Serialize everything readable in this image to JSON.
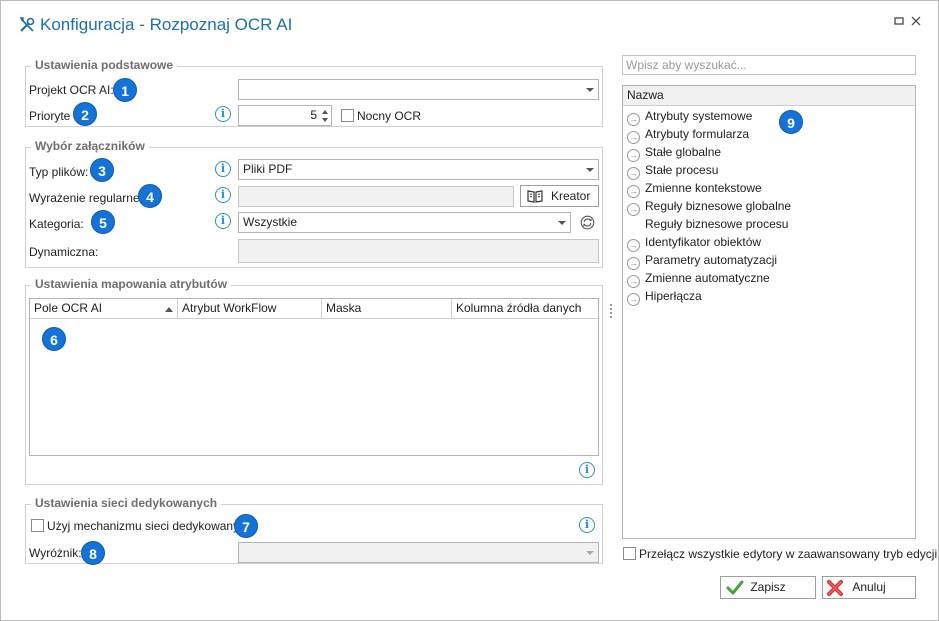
{
  "window": {
    "title": "Konfiguracja - Rozpoznaj OCR AI"
  },
  "basic": {
    "legend": "Ustawienia podstawowe",
    "project_label": "Projekt OCR AI:",
    "project_value": "",
    "priority_label": "Prioryte",
    "priority_value": "5",
    "night_ocr_label": "Nocny OCR",
    "night_ocr_checked": false
  },
  "attachments": {
    "legend": "Wybór załączników",
    "file_type_label": "Typ plików:",
    "file_type_value": "Pliki PDF",
    "regex_label": "Wyrażenie regularne:",
    "regex_value": "",
    "wizard_label": "Kreator",
    "category_label": "Kategoria:",
    "category_value": "Wszystkie",
    "dynamic_label": "Dynamiczna:",
    "dynamic_value": ""
  },
  "mapping": {
    "legend": "Ustawienia mapowania atrybutów",
    "columns": [
      "Pole OCR AI",
      "Atrybut WorkFlow",
      "Maska",
      "Kolumna źródła danych"
    ],
    "rows": []
  },
  "network": {
    "legend": "Ustawienia sieci dedykowanych",
    "use_label": "Użyj mechanizmu sieci dedykowanych",
    "use_checked": false,
    "marker_label": "Wyróżnik:",
    "marker_value": ""
  },
  "badges": [
    "1",
    "2",
    "3",
    "4",
    "5",
    "6",
    "7",
    "8",
    "9"
  ],
  "right": {
    "search_placeholder": "Wpisz aby wyszukać...",
    "tree_header": "Nazwa",
    "items": [
      {
        "label": "Atrybuty systemowe",
        "icon": "arrow-right-circle-icon"
      },
      {
        "label": "Atrybuty formularza",
        "icon": "arrow-right-circle-icon"
      },
      {
        "label": "Stałe globalne",
        "icon": "arrow-right-circle-icon"
      },
      {
        "label": "Stałe procesu",
        "icon": "arrow-right-circle-icon"
      },
      {
        "label": "Zmienne kontekstowe",
        "icon": "arrow-right-circle-icon"
      },
      {
        "label": "Reguły biznesowe globalne",
        "icon": "arrow-right-circle-icon"
      },
      {
        "label": "Reguły biznesowe procesu",
        "icon": ""
      },
      {
        "label": "Identyfikator obiektów",
        "icon": "arrow-right-circle-icon"
      },
      {
        "label": "Parametry automatyzacji",
        "icon": "arrow-right-circle-icon"
      },
      {
        "label": "Zmienne automatyczne",
        "icon": "arrow-right-circle-icon"
      },
      {
        "label": "Hiperłącza",
        "icon": "arrow-right-circle-icon"
      }
    ],
    "advanced_label": "Przełącz wszystkie edytory w zaawansowany tryb edycji",
    "advanced_checked": false
  },
  "footer": {
    "save_label": "Zapisz",
    "cancel_label": "Anuluj"
  },
  "colors": {
    "accent": "#1572d6",
    "title": "#1d6fb0",
    "info": "#2a8fd8",
    "save_icon": "#3aa832",
    "cancel_icon": "#d62d2d"
  }
}
